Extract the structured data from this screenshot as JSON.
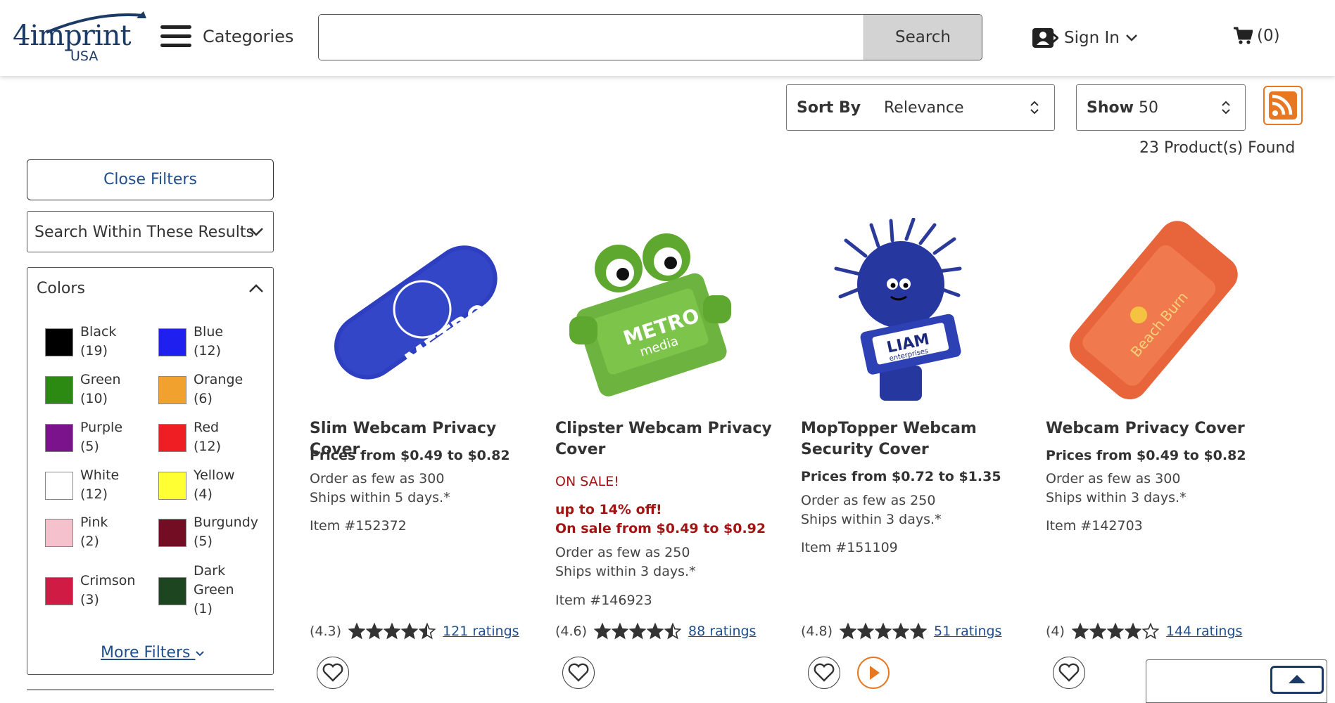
{
  "header": {
    "logo_text": "4imprint",
    "logo_sub": "USA",
    "categories_label": "Categories",
    "search_placeholder": "",
    "search_button": "Search",
    "signin_label": "Sign In",
    "cart_label": "(0)"
  },
  "toolbar": {
    "sort_label": "Sort By",
    "sort_value": "Relevance",
    "show_label": "Show",
    "show_value": "50",
    "products_found": "23 Product(s) Found"
  },
  "sidebar": {
    "close_filters": "Close Filters",
    "search_within": "Search Within These Results",
    "colors_title": "Colors",
    "colors": [
      {
        "name": "Black",
        "count": "(19)",
        "hex": "#000000"
      },
      {
        "name": "Blue",
        "count": "(12)",
        "hex": "#1f1ff0"
      },
      {
        "name": "Green",
        "count": "(10)",
        "hex": "#2c8a13"
      },
      {
        "name": "Orange",
        "count": "(6)",
        "hex": "#f0a12e"
      },
      {
        "name": "Purple",
        "count": "(5)",
        "hex": "#7a138c"
      },
      {
        "name": "Red",
        "count": "(12)",
        "hex": "#ee1e22"
      },
      {
        "name": "White",
        "count": "(12)",
        "hex": "#ffffff"
      },
      {
        "name": "Yellow",
        "count": "(4)",
        "hex": "#ffff33"
      },
      {
        "name": "Pink",
        "count": "(2)",
        "hex": "#f5c1cc"
      },
      {
        "name": "Burgundy",
        "count": "(5)",
        "hex": "#720d24"
      },
      {
        "name": "Crimson",
        "count": "(3)",
        "hex": "#d01c45"
      },
      {
        "name": "Dark Green",
        "count": "(1)",
        "hex": "#1d4520"
      }
    ],
    "more_filters": "More Filters"
  },
  "products": [
    {
      "title": "Slim Webcam Privacy Cover",
      "price": "Prices from $0.49 to $0.82",
      "min_order": "Order as few as 300",
      "ships": "Ships within 5 days.*",
      "item": "Item #152372",
      "rating": "(4.3)",
      "rating_value": 4.3,
      "ratings_count": "121 ratings",
      "image": "blue slim webcam cover",
      "image_text": [
        "METRO",
        "media"
      ]
    },
    {
      "title": "Clipster Webcam Privacy Cover",
      "sale_badge": "ON SALE!",
      "sale_pct": "up to 14% off!",
      "sale_price": "On sale from $0.49 to $0.92",
      "min_order": "Order as few as 250",
      "ships": "Ships within 3 days.*",
      "item": "Item #146923",
      "rating": "(4.6)",
      "rating_value": 4.6,
      "ratings_count": "88 ratings",
      "image": "green frog webcam clip",
      "image_text": [
        "METRO",
        "media"
      ]
    },
    {
      "title": "MopTopper Webcam Security Cover",
      "price": "Prices from $0.72 to $1.35",
      "min_order": "Order as few as 250",
      "ships": "Ships within 3 days.*",
      "item": "Item #151109",
      "rating": "(4.8)",
      "rating_value": 4.8,
      "ratings_count": "51 ratings",
      "image": "blue moptopper character",
      "image_text": [
        "LIAM",
        "enterprises"
      ]
    },
    {
      "title": "Webcam Privacy Cover",
      "price": "Prices from $0.49 to $0.82",
      "min_order": "Order as few as 300",
      "ships": "Ships within 3 days.*",
      "item": "Item #142703",
      "rating": "(4)",
      "rating_value": 4,
      "ratings_count": "144 ratings",
      "image": "orange sliding webcam cover",
      "image_text": [
        "Beach",
        "Burn"
      ]
    }
  ],
  "colors": {
    "brand_blue": "#1f4e8c",
    "sale_red": "#a31515",
    "rss_orange": "#e87722"
  }
}
